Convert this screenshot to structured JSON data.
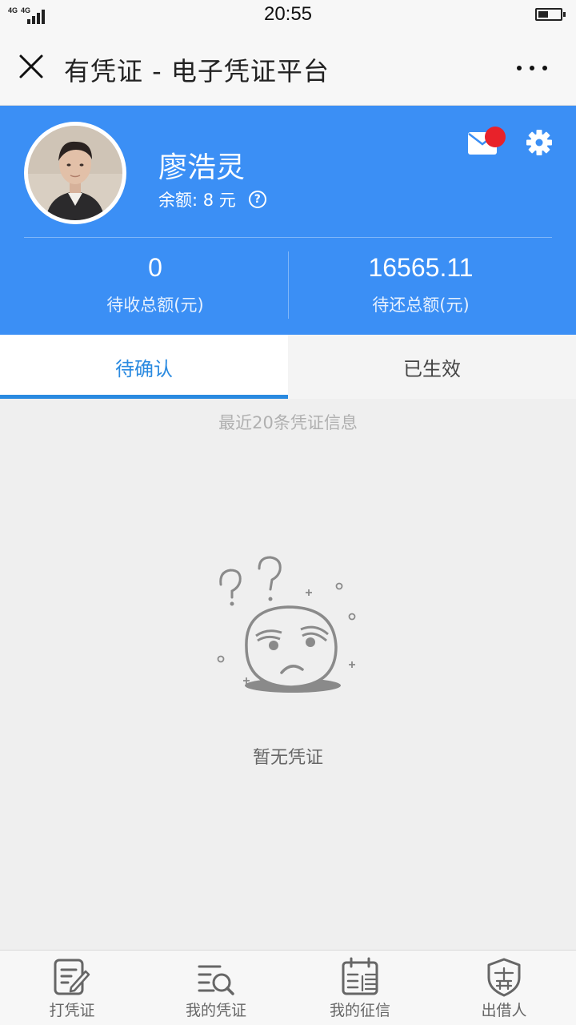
{
  "status_bar": {
    "network_labels": [
      "4G",
      "4G"
    ],
    "time": "20:55"
  },
  "title_bar": {
    "title": "有凭证 - 电子凭证平台",
    "close_icon": "close-icon",
    "more_icon": "more-dots-icon"
  },
  "profile": {
    "name": "廖浩灵",
    "balance": "余额: 8 元",
    "help_symbol": "?",
    "mail_has_unread": true,
    "stats": [
      {
        "value": "0",
        "label": "待收总额(元)"
      },
      {
        "value": "16565.11",
        "label": "待还总额(元)"
      }
    ]
  },
  "tabs": [
    {
      "label": "待确认",
      "active": true
    },
    {
      "label": "已生效",
      "active": false
    }
  ],
  "content": {
    "recent_note": "最近20条凭证信息",
    "empty_text": "暂无凭证"
  },
  "bottom_nav": [
    {
      "label": "打凭证",
      "icon": "edit-document-icon"
    },
    {
      "label": "我的凭证",
      "icon": "list-search-icon"
    },
    {
      "label": "我的征信",
      "icon": "credit-calendar-icon"
    },
    {
      "label": "出借人",
      "icon": "lender-shield-icon",
      "badge": "出借"
    }
  ],
  "colors": {
    "accent": "#3b8ff5",
    "tab_active": "#2a8ae0",
    "notify_dot": "#e8222a"
  }
}
